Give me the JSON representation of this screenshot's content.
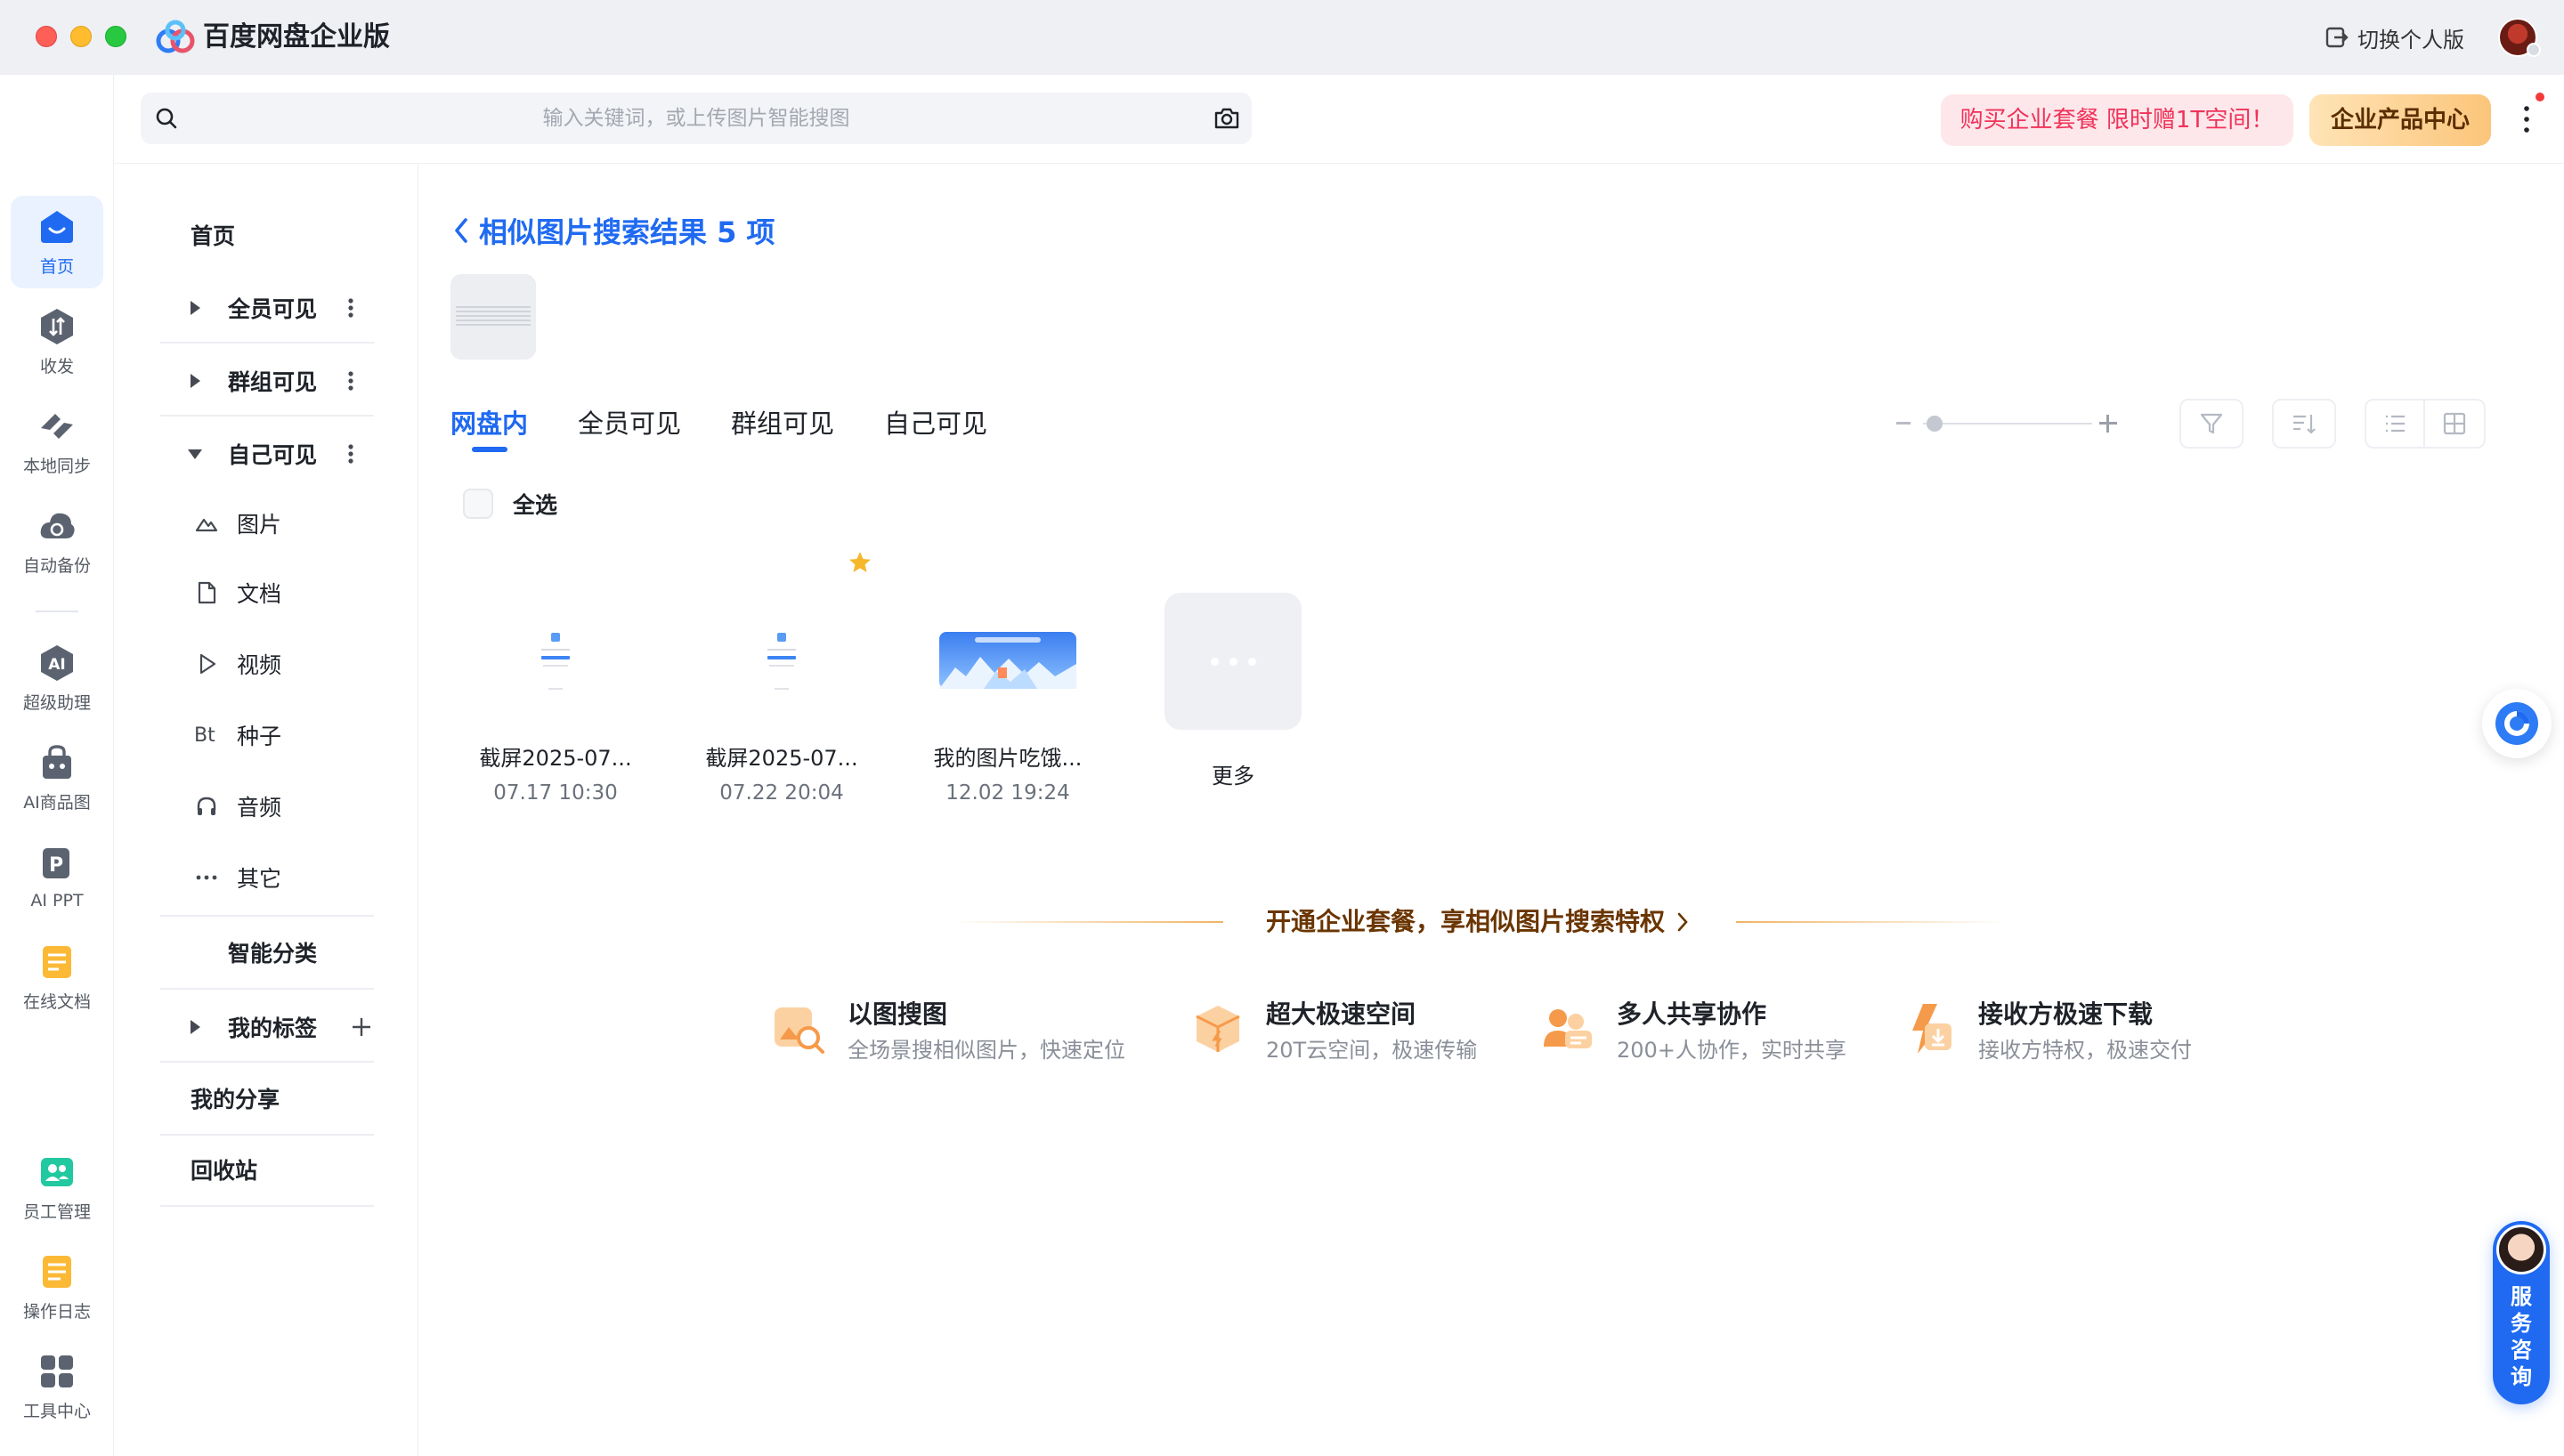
{
  "app": {
    "title": "百度网盘企业版",
    "switch_label": "切换个人版"
  },
  "rail": {
    "items": [
      {
        "label": "首页",
        "icon": "home-icon"
      },
      {
        "label": "收发",
        "icon": "transfer-icon"
      },
      {
        "label": "本地同步",
        "icon": "sync-icon"
      },
      {
        "label": "自动备份",
        "icon": "backup-icon"
      },
      {
        "label": "超级助理",
        "icon": "ai-assistant-icon"
      },
      {
        "label": "AI商品图",
        "icon": "ai-product-image-icon"
      },
      {
        "label": "AI PPT",
        "icon": "ai-ppt-icon"
      },
      {
        "label": "在线文档",
        "icon": "online-doc-icon"
      },
      {
        "label": "员工管理",
        "icon": "staff-icon"
      },
      {
        "label": "操作日志",
        "icon": "log-icon"
      },
      {
        "label": "工具中心",
        "icon": "tools-icon"
      }
    ]
  },
  "search": {
    "placeholder": "输入关键词，或上传图片智能搜图"
  },
  "promo": {
    "label": "购买企业套餐 限时赠1T空间！"
  },
  "enterprise_center": {
    "label": "企业产品中心"
  },
  "tree": {
    "home": "首页",
    "all_visible": "全员可见",
    "group_visible": "群组可见",
    "self_visible": "自己可见",
    "categories": [
      {
        "label": "图片",
        "icon": "image-icon"
      },
      {
        "label": "文档",
        "icon": "document-icon"
      },
      {
        "label": "视频",
        "icon": "video-icon"
      },
      {
        "label": "种子",
        "icon": "torrent-icon",
        "icon_text": "Bt"
      },
      {
        "label": "音频",
        "icon": "audio-icon"
      },
      {
        "label": "其它",
        "icon": "other-icon"
      }
    ],
    "smart_category": "智能分类",
    "my_tags": "我的标签",
    "my_share": "我的分享",
    "recycle": "回收站"
  },
  "result": {
    "title": "相似图片搜索结果 5 项",
    "tabs": [
      "网盘内",
      "全员可见",
      "群组可见",
      "自己可见"
    ],
    "active_tab": 0,
    "select_all": "全选",
    "files": [
      {
        "name": "截屏2025-07...",
        "date": "07.17 10:30"
      },
      {
        "name": "截屏2025-07...",
        "date": "07.22 20:04"
      },
      {
        "name": "我的图片吃饿...",
        "date": "12.02 19:24"
      }
    ],
    "more_label": "更多"
  },
  "upsell": {
    "text": "开通企业套餐，享相似图片搜索特权",
    "features": [
      {
        "title": "以图搜图",
        "desc": "全场景搜相似图片，快速定位",
        "icon": "image-search-icon"
      },
      {
        "title": "超大极速空间",
        "desc": "20T云空间，极速传输",
        "icon": "storage-box-icon"
      },
      {
        "title": "多人共享协作",
        "desc": "200+人协作，实时共享",
        "icon": "team-icon"
      },
      {
        "title": "接收方极速下载",
        "desc": "接收方特权，极速交付",
        "icon": "fast-download-icon"
      }
    ]
  },
  "service": {
    "label": "服务咨询"
  },
  "colors": {
    "accent": "#1f6af1",
    "promo_text": "#f0325a",
    "upsell_text": "#6a3500"
  }
}
